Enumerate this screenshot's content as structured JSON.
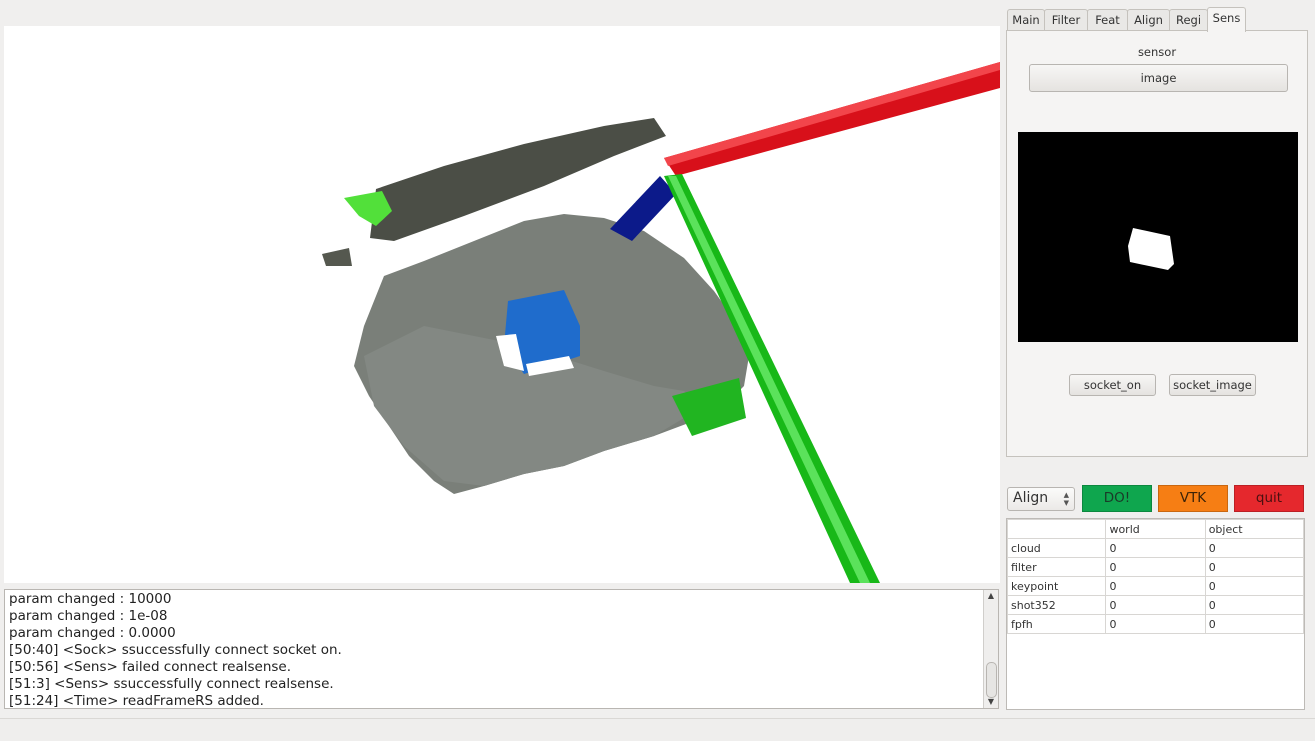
{
  "tabs": [
    "Main",
    "Filter",
    "Feat",
    "Align",
    "Regi",
    "Sens"
  ],
  "active_tab": "Sens",
  "sensor_panel": {
    "label": "sensor",
    "image_button": "image",
    "socket_on_button": "socket_on",
    "socket_image_button": "socket_image"
  },
  "controls": {
    "mode_select": "Align",
    "do_button": "DO!",
    "vtk_button": "VTK",
    "quit_button": "quit",
    "colors": {
      "do": "#0fa64e",
      "vtk": "#f67e14",
      "quit": "#e5282d"
    }
  },
  "table": {
    "headers": [
      "",
      "world",
      "object"
    ],
    "rows": [
      [
        "cloud",
        "0",
        "0"
      ],
      [
        "filter",
        "0",
        "0"
      ],
      [
        "keypoint",
        "0",
        "0"
      ],
      [
        "shot352",
        "0",
        "0"
      ],
      [
        "fpfh",
        "0",
        "0"
      ]
    ]
  },
  "console": {
    "lines": [
      "param changed : 10000",
      "param changed : 1e-08",
      "param changed : 0.0000",
      "[50:40] <Sock>  ssuccessfully connect socket on.",
      "[50:56] <Sens>  failed connect realsense.",
      "[51:3] <Sens>  ssuccessfully connect realsense.",
      "[51:24] <Time>  readFrameRS added."
    ]
  },
  "axes_colors": {
    "x": "#e0101a",
    "y": "#1fc41f",
    "z": "#0c1a8a"
  }
}
